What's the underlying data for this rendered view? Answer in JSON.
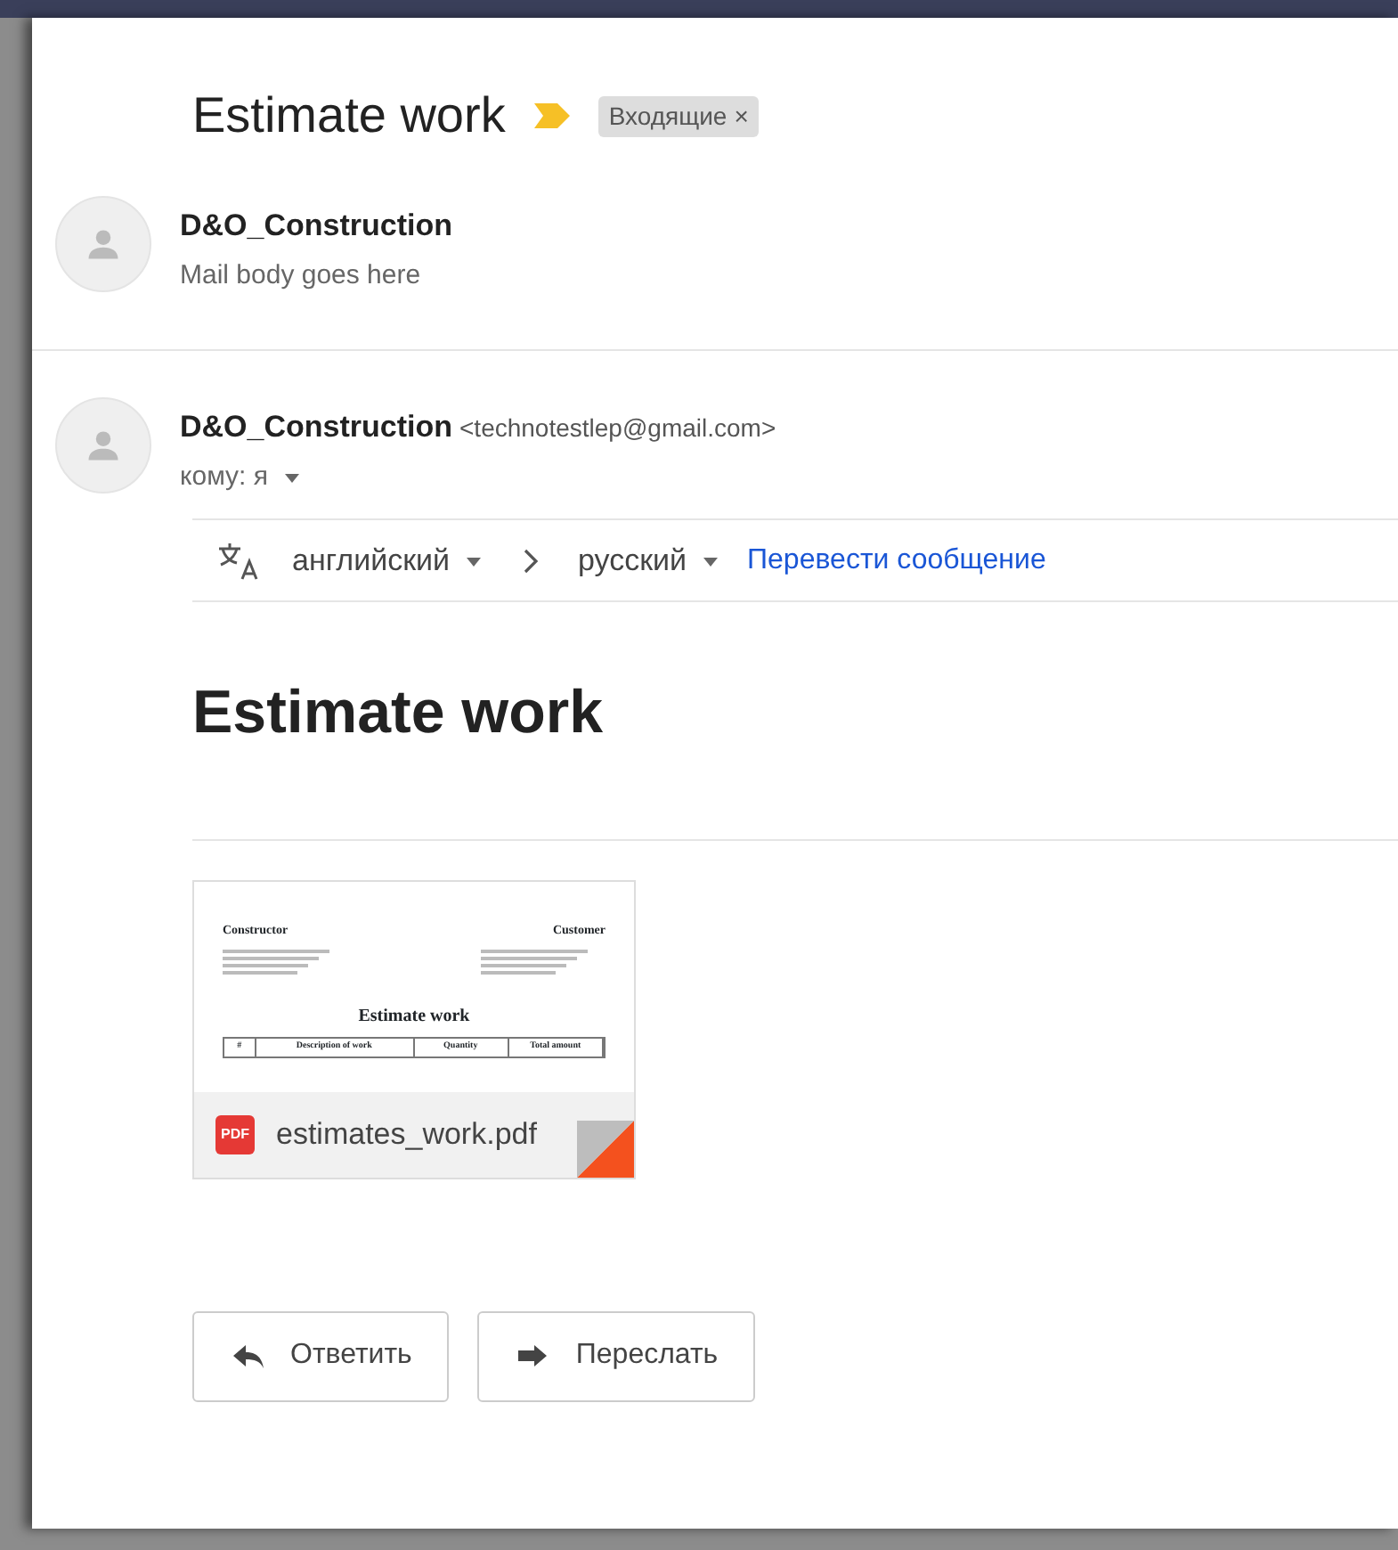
{
  "subject": {
    "title": "Estimate work",
    "important": true,
    "labels": [
      {
        "text": "Входящие",
        "remove": "×"
      }
    ]
  },
  "collapsed_message": {
    "sender": "D&O_Construction",
    "snippet": "Mail body goes here"
  },
  "open_message": {
    "sender": "D&O_Construction",
    "email": "<technotestlep@gmail.com>",
    "recipient": "кому: я"
  },
  "translate_bar": {
    "from": "английский",
    "to": "русский",
    "action": "Перевести сообщение"
  },
  "body": {
    "heading": "Estimate work"
  },
  "attachment": {
    "filename": "estimates_work.pdf",
    "badge": "PDF",
    "preview": {
      "left_heading": "Constructor",
      "right_heading": "Customer",
      "title": "Estimate work",
      "columns": [
        "#",
        "Description of work",
        "Quantity",
        "Total amount"
      ]
    }
  },
  "actions": [
    {
      "kind": "reply",
      "label": "Ответить"
    },
    {
      "kind": "forward",
      "label": "Переслать"
    }
  ]
}
